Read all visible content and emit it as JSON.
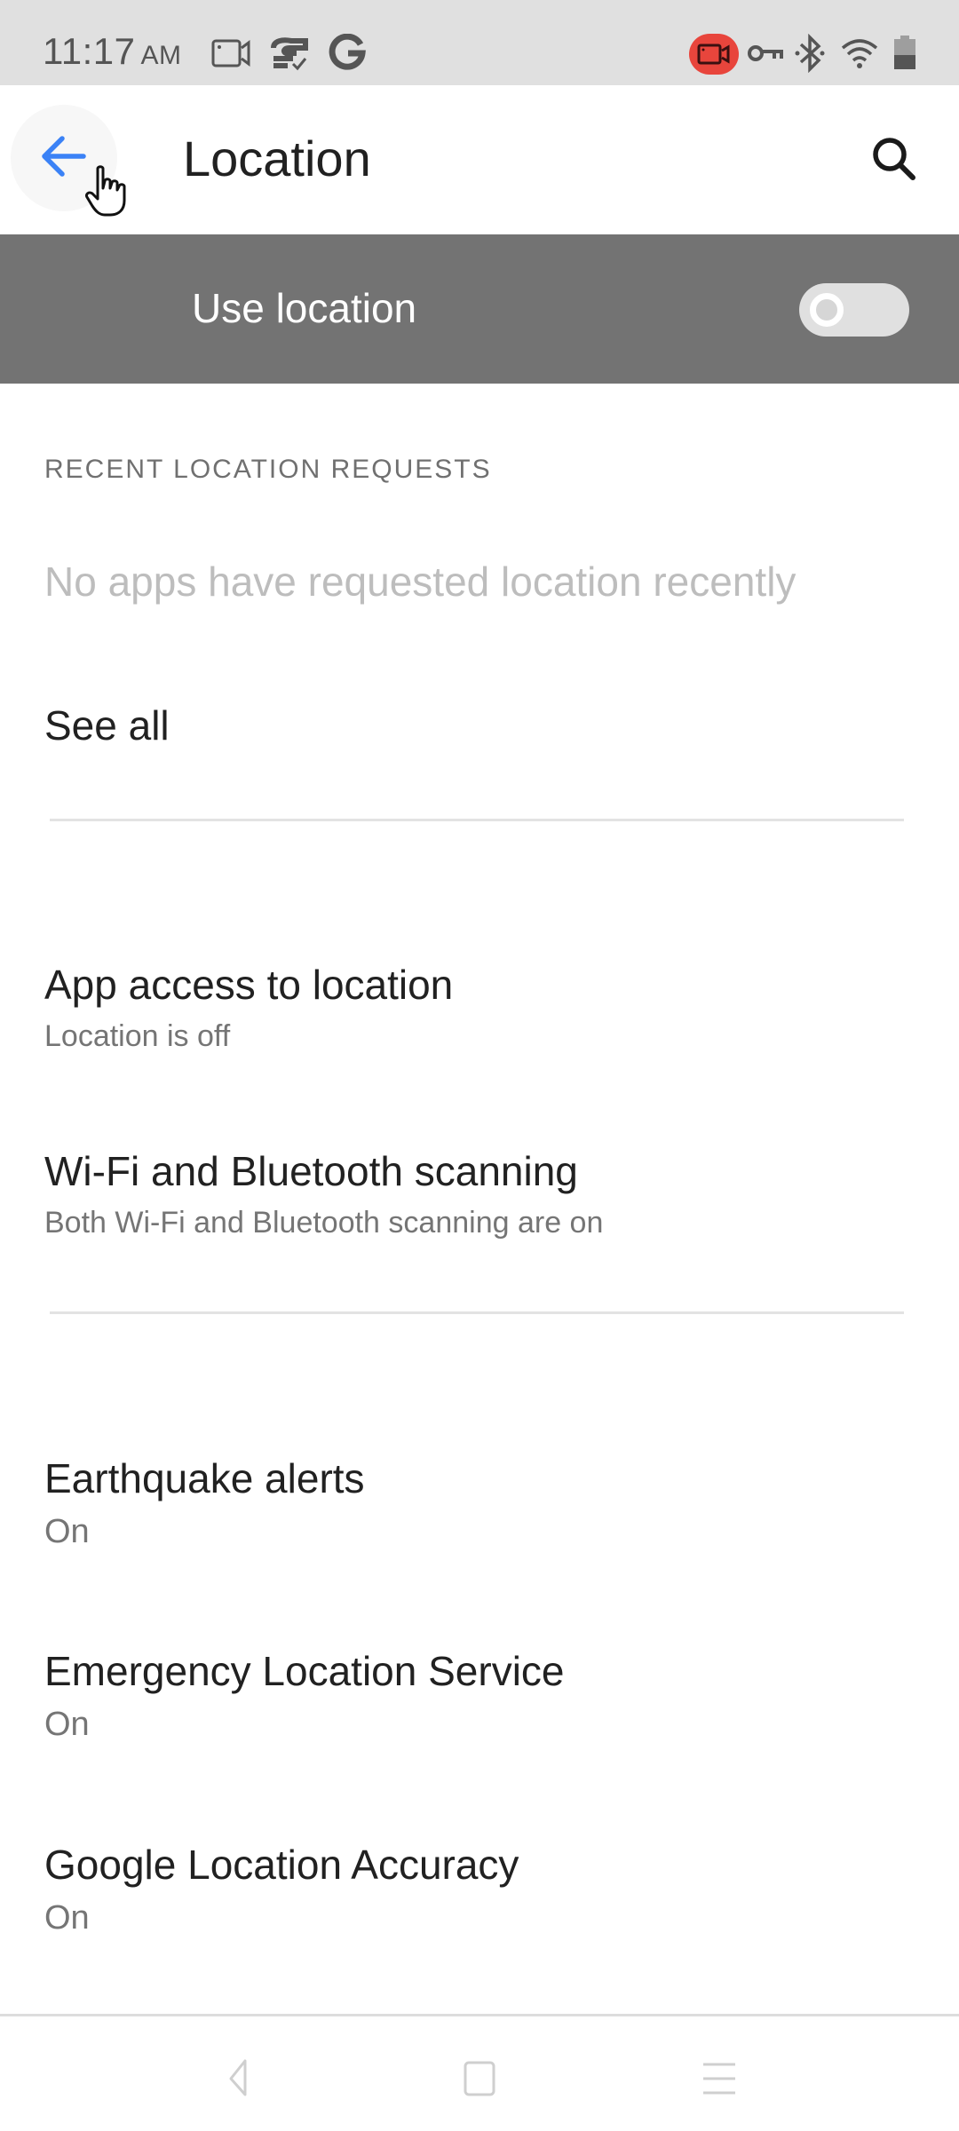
{
  "status_bar": {
    "time": "11:17",
    "ampm": "AM",
    "left_icons": [
      "screen-record-icon",
      "sync-check-icon",
      "google-icon"
    ],
    "right_icons": [
      "recording-active-icon",
      "vpn-key-icon",
      "bluetooth-icon",
      "wifi-icon",
      "battery-icon"
    ],
    "recording_color": "#e8453c"
  },
  "app_bar": {
    "title": "Location",
    "back_icon": "arrow-back-icon",
    "search_icon": "search-icon",
    "accent_color": "#3b82f6"
  },
  "master_switch": {
    "label": "Use location",
    "state": "off"
  },
  "recent_requests": {
    "header": "RECENT LOCATION REQUESTS",
    "empty_message": "No apps have requested location recently",
    "see_all_label": "See all"
  },
  "preferences": [
    {
      "title": "App access to location",
      "summary": "Location is off"
    },
    {
      "title": "Wi-Fi and Bluetooth scanning",
      "summary": "Both Wi-Fi and Bluetooth scanning are on"
    },
    {
      "title": "Earthquake alerts",
      "summary": "On"
    },
    {
      "title": "Emergency Location Service",
      "summary": "On"
    },
    {
      "title": "Google Location Accuracy",
      "summary": "On"
    }
  ],
  "nav_bar": {
    "buttons": [
      "nav-back-icon",
      "nav-home-icon",
      "nav-menu-icon"
    ]
  }
}
